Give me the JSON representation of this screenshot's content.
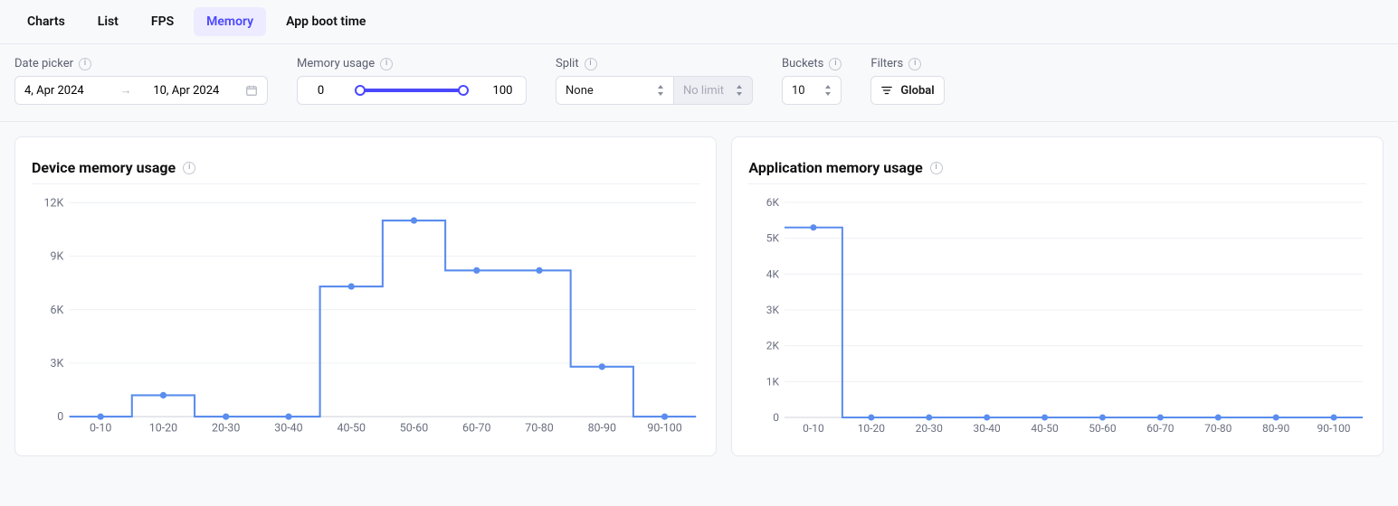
{
  "tabs": [
    {
      "label": "Charts",
      "active": false
    },
    {
      "label": "List",
      "active": false
    },
    {
      "label": "FPS",
      "active": false
    },
    {
      "label": "Memory",
      "active": true
    },
    {
      "label": "App boot time",
      "active": false
    }
  ],
  "filters": {
    "date_picker": {
      "label": "Date picker",
      "from": "4, Apr 2024",
      "to": "10, Apr 2024"
    },
    "memory_usage": {
      "label": "Memory usage",
      "min": "0",
      "max": "100"
    },
    "split": {
      "label": "Split",
      "value": "None",
      "limit": "No limit"
    },
    "buckets": {
      "label": "Buckets",
      "value": "10"
    },
    "filters_label": "Filters",
    "global": "Global"
  },
  "cards": {
    "device": {
      "title": "Device memory usage"
    },
    "app": {
      "title": "Application memory usage"
    }
  },
  "chart_data": [
    {
      "type": "bar",
      "id": "device",
      "title": "Device memory usage",
      "categories": [
        "0-10",
        "10-20",
        "20-30",
        "30-40",
        "40-50",
        "50-60",
        "60-70",
        "70-80",
        "80-90",
        "90-100"
      ],
      "values": [
        0,
        1200,
        0,
        0,
        7300,
        11000,
        8200,
        8200,
        2800,
        0
      ],
      "ylabel": "",
      "ylim": [
        0,
        12000
      ],
      "yticks": [
        0,
        3000,
        6000,
        9000,
        12000
      ],
      "ytick_labels": [
        "0",
        "3K",
        "6K",
        "9K",
        "12K"
      ]
    },
    {
      "type": "bar",
      "id": "app",
      "title": "Application memory usage",
      "categories": [
        "0-10",
        "10-20",
        "20-30",
        "30-40",
        "40-50",
        "50-60",
        "60-70",
        "70-80",
        "80-90",
        "90-100"
      ],
      "values": [
        5300,
        0,
        0,
        0,
        0,
        0,
        0,
        0,
        0,
        0
      ],
      "ylabel": "",
      "ylim": [
        0,
        6000
      ],
      "yticks": [
        0,
        1000,
        2000,
        3000,
        4000,
        5000,
        6000
      ],
      "ytick_labels": [
        "0",
        "1K",
        "2K",
        "3K",
        "4K",
        "5K",
        "6K"
      ]
    }
  ]
}
